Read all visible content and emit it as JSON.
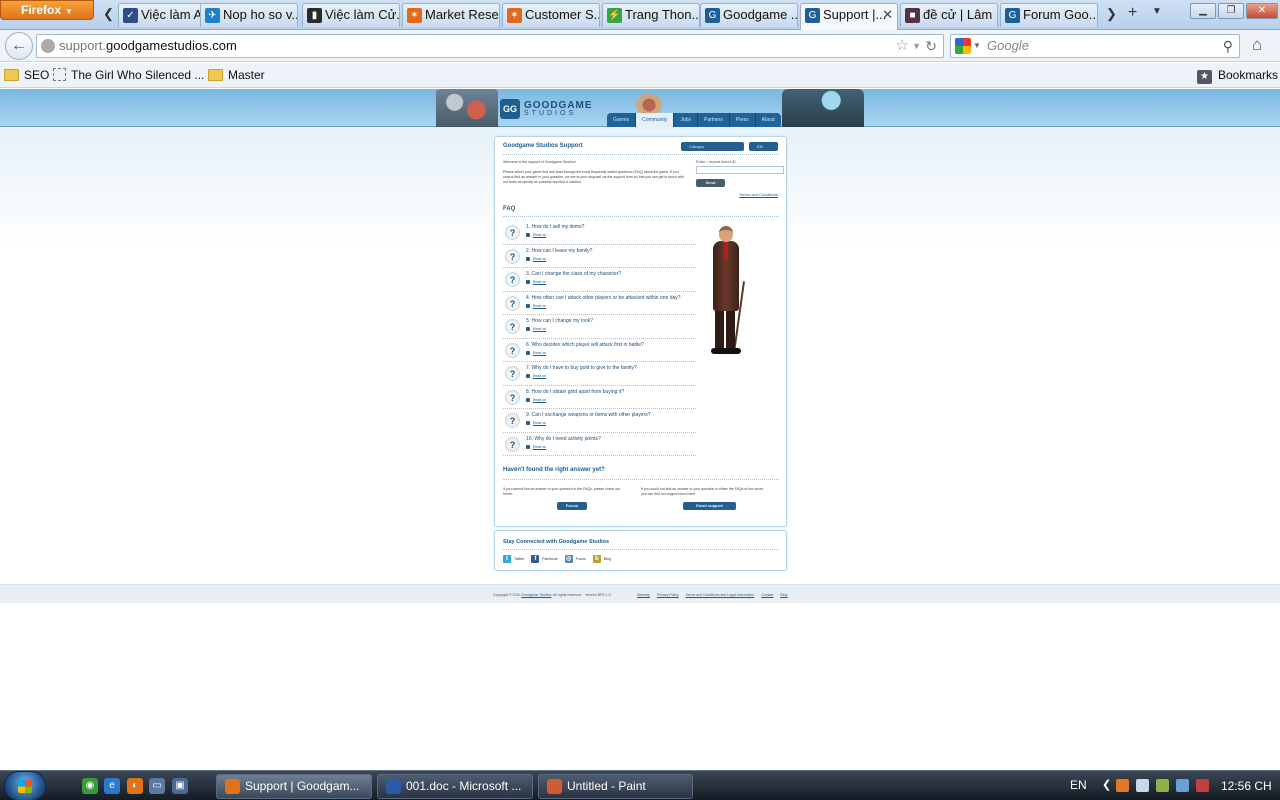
{
  "browser": {
    "menu_button": "Firefox",
    "tabs": [
      {
        "label": "Việc làm Ac...",
        "icon": "#2c4f8a",
        "glyph": "✓"
      },
      {
        "label": "Nop ho so v...",
        "icon": "#1f7fd0",
        "glyph": "✈"
      },
      {
        "label": "Việc làm Cử...",
        "icon": "#2a2a2a",
        "glyph": "▮"
      },
      {
        "label": "Market Rese...",
        "icon": "#e06a1a",
        "glyph": "✶"
      },
      {
        "label": "Customer S...",
        "icon": "#e06a1a",
        "glyph": "✶"
      },
      {
        "label": "Trang Thon...",
        "icon": "#3aa34a",
        "glyph": "⚡"
      },
      {
        "label": "Goodgame ...",
        "icon": "#1f5f99",
        "glyph": "G"
      },
      {
        "label": "Support |...",
        "icon": "#1f5f99",
        "glyph": "G"
      },
      {
        "label": "đề cử | Lâm ...",
        "icon": "#553344",
        "glyph": "■"
      },
      {
        "label": "Forum Goo...",
        "icon": "#1f5f99",
        "glyph": "G"
      }
    ],
    "active_tab_index": 7,
    "url_prefix": "support.",
    "url_domain": "goodgamestudios.com",
    "search_placeholder": "Google",
    "bookmarks": [
      {
        "label": "SEO",
        "type": "folder"
      },
      {
        "label": "The Girl Who Silenced ...",
        "type": "page"
      },
      {
        "label": "Master",
        "type": "folder"
      }
    ],
    "bookmarks_menu": "Bookmarks"
  },
  "site": {
    "logo_line1": "GOODGAME",
    "logo_line2": "STUDIOS",
    "nav": [
      "Games",
      "Community",
      "Jobs",
      "Partners",
      "Press",
      "About"
    ],
    "nav_selected": 1,
    "support_title": "Goodgame Studios Support",
    "category_select": "Categoo",
    "language_select": "EN",
    "welcome": "Welcome to the support of Goodgame Studios!",
    "intro": "Please select your game first and read through the most frequently asked questions (FAQ) about the game. If you cannot find an answer to your question, we are at your disposal via the support form so that you can get in touch with our team as quickly as possible and find a solution.",
    "ticket_label": "Enter / repeat ticket ID",
    "send_button": "Send",
    "terms_link": "Terms and Conditions",
    "faq_title": "FAQ",
    "faq": [
      {
        "q": "1. How do I sell my items?",
        "more": "Read on"
      },
      {
        "q": "2. How can I leave my family?",
        "more": "Read on"
      },
      {
        "q": "3. Can I change the class of my character?",
        "more": "Read on"
      },
      {
        "q": "4. How often can I attack other players or be attacked within one day?",
        "more": "Read on"
      },
      {
        "q": "5. How can I change my look?",
        "more": "Read on"
      },
      {
        "q": "6. Who decides which player will attack first in battle?",
        "more": "Read on"
      },
      {
        "q": "7. Why do I have to buy gold to give to the family?",
        "more": "Read on"
      },
      {
        "q": "8. How do I obtain gold apart from buying it?",
        "more": "Read on"
      },
      {
        "q": "9. Can I exchange weapons or items with other players?",
        "more": "Read on"
      },
      {
        "q": "10. Why do I need activity points?",
        "more": "Read on"
      }
    ],
    "not_found_title": "Haven't found the right answer yet?",
    "nf_forum_text": "If you cannot find an answer to your question in the FAQs, please check our forum.",
    "nf_email_text": "If you could not find an answer to your question in either the FAQs or the forum, you can find our support form here!",
    "forum_button": "Forum",
    "email_button": "Email support",
    "social_title": "Stay Connected with Goodgame Studios",
    "social": [
      {
        "label": "Twitter",
        "color": "#2fa7e0",
        "glyph": "t"
      },
      {
        "label": "Facebook",
        "color": "#3b5998",
        "glyph": "f"
      },
      {
        "label": "Forum",
        "color": "#5e88a8",
        "glyph": "◎"
      },
      {
        "label": "Blog",
        "color": "#b8a030",
        "glyph": "b"
      }
    ],
    "copyright_pre": "Copyright © 2010",
    "copyright_link": "Goodgame Studios",
    "copyright_post": ". All rights reserved. · Version BPS 1.0",
    "footer_links": [
      "Sitemap",
      "Privacy Policy",
      "Terms and Conditions and Legal Information",
      "Contact",
      "Blog"
    ]
  },
  "taskbar": {
    "quicklaunch": [
      {
        "name": "chrome",
        "color": "#3a9a3a",
        "glyph": "◉"
      },
      {
        "name": "ie",
        "color": "#2a7bd0",
        "glyph": "e"
      },
      {
        "name": "firefox",
        "color": "#e0731a",
        "glyph": "◐"
      },
      {
        "name": "desktop",
        "color": "#5a7aa0",
        "glyph": "▭"
      },
      {
        "name": "switch-windows",
        "color": "#4a6a90",
        "glyph": "▣"
      }
    ],
    "tasks": [
      {
        "label": "Support | Goodgam...",
        "icon": "#e0731a"
      },
      {
        "label": "001.doc - Microsoft ...",
        "icon": "#2a5aa8"
      },
      {
        "label": "Untitled - Paint",
        "icon": "#d05a3a"
      }
    ],
    "active_task": 0,
    "language": "EN",
    "clock": "12:56 CH"
  }
}
